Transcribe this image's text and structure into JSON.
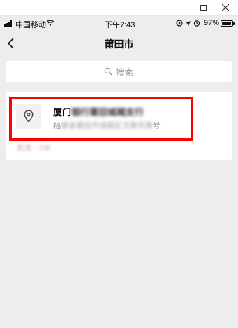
{
  "status_bar": {
    "carrier": "中国移动",
    "time": "下午7:43",
    "battery": "97%"
  },
  "nav": {
    "title": "莆田市"
  },
  "search": {
    "placeholder": "搜索"
  },
  "result": {
    "title_visible": "厦门",
    "title_obscured": "银行莆田城厢支行",
    "address_visible": "福",
    "address_obscured": "建省莆田市城厢区文献东路",
    "address_suffix": "号",
    "faded_line": "距离 · 3米"
  },
  "icons": {
    "back": "chevron-left-icon",
    "search": "search-icon",
    "pin": "location-pin-icon",
    "wifi": "wifi-icon"
  },
  "colors": {
    "highlight": "#ff0000",
    "background": "#ededed",
    "card": "#ffffff"
  }
}
